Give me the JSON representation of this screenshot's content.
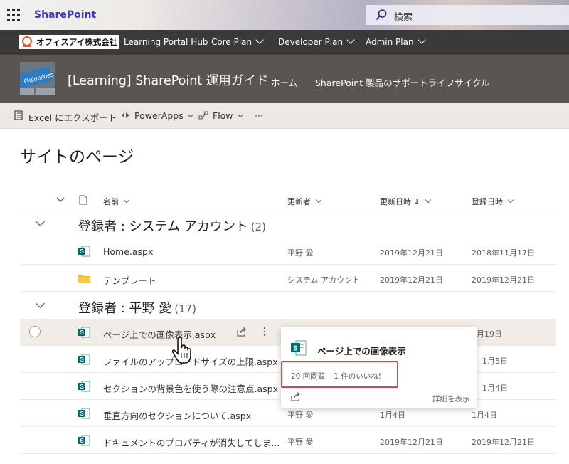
{
  "suite": {
    "app_name": "SharePoint",
    "search_placeholder": "検索"
  },
  "hub": {
    "logo_text": "オフィスアイ株式会社",
    "links": [
      {
        "label": "Learning Portal Hub",
        "has_menu": false
      },
      {
        "label": "Core Plan",
        "has_menu": true
      },
      {
        "label": "Developer Plan",
        "has_menu": true
      },
      {
        "label": "Admin Plan",
        "has_menu": true
      }
    ]
  },
  "site": {
    "logo_text": "Guidelines",
    "title": "[Learning] SharePoint 運用ガイド",
    "nav": [
      "ホーム",
      "SharePoint 製品のサポートライフサイクル"
    ]
  },
  "commands": {
    "excel": "Excel にエクスポート",
    "powerapps": "PowerApps",
    "flow": "Flow",
    "more": "···"
  },
  "page": {
    "title": "サイトのページ"
  },
  "columns": {
    "name": "名前",
    "modified_by": "更新者",
    "modified": "更新日時",
    "created": "登録日時",
    "sort_arrow": "↓"
  },
  "groups": [
    {
      "label": "登録者 : システム アカウント",
      "count": "(2)",
      "rows": [
        {
          "name": "Home.aspx",
          "type": "page",
          "modified_by": "平野 愛",
          "modified": "2019年12月21日",
          "created": "2018年11月17日"
        },
        {
          "name": "テンプレート",
          "type": "folder",
          "modified_by": "システム アカウント",
          "modified": "2019年12月21日",
          "created": "2019年12月21日"
        }
      ]
    },
    {
      "label": "登録者 : 平野 愛",
      "count": "(17)",
      "rows": [
        {
          "name": "ページ上での画像表示.aspx",
          "type": "page",
          "modified_by": "",
          "modified": "",
          "created": "1月19日"
        },
        {
          "name": "ファイルのアップロードサイズの上限.aspx",
          "type": "page",
          "modified_by": "",
          "modified": "",
          "created": "1月5日"
        },
        {
          "name": "セクションの背景色を使う際の注意点.aspx",
          "type": "page",
          "modified_by": "",
          "modified": "",
          "created": "1月4日"
        },
        {
          "name": "垂直方向のセクションについて.aspx",
          "type": "page",
          "modified_by": "平野 愛",
          "modified": "1月4日",
          "created": "1月4日"
        },
        {
          "name": "ドキュメントのプロパティが消失してしま...",
          "type": "page",
          "modified_by": "平野 愛",
          "modified": "2019年12月21日",
          "created": "2019年12月21日"
        }
      ]
    }
  ],
  "hovercard": {
    "title": "ページ上での画像表示",
    "views": "20 回閲覧",
    "likes": "1 件のいいね!",
    "details": "詳細を表示"
  },
  "colors": {
    "sharepoint_teal": "#036c70",
    "hub_bar": "#3b3a39",
    "site_header": "#5a5550",
    "command_bar": "#ede8e3",
    "highlight_box": "#e0434b",
    "brand_text": "#3d3ab6"
  }
}
